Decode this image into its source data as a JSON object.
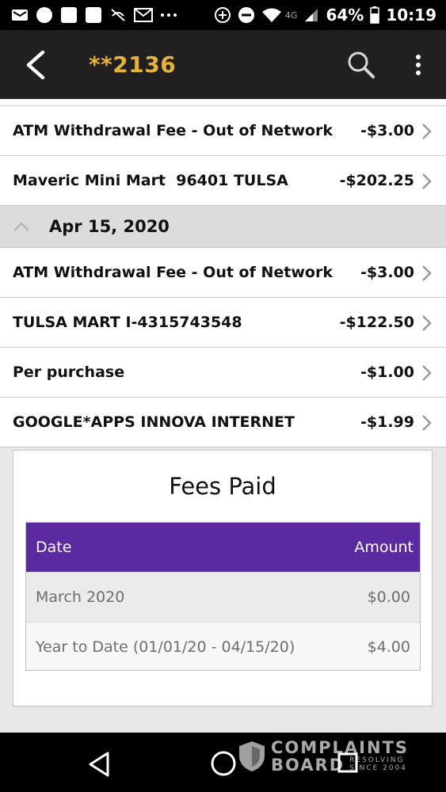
{
  "status_bar": {
    "battery": "64%",
    "time": "10:19",
    "network": "4G"
  },
  "app_bar": {
    "title": "**2136",
    "back_icon": "back-arrow-icon",
    "search_icon": "search-icon",
    "menu_icon": "more-vert-icon"
  },
  "transactions": {
    "group1": [
      {
        "description": "ATM Withdrawal Fee - Out of Network",
        "amount": "-$3.00"
      },
      {
        "description": "Maveric Mini Mart  96401 TULSA",
        "amount": "-$202.25"
      }
    ],
    "group2_date": "Apr 15, 2020",
    "group2": [
      {
        "description": "ATM Withdrawal Fee - Out of Network",
        "amount": "-$3.00"
      },
      {
        "description": "TULSA MART I-4315743548",
        "amount": "-$122.50"
      },
      {
        "description": "Per purchase",
        "amount": "-$1.00"
      },
      {
        "description": "GOOGLE*APPS INNOVA INTERNET",
        "amount": "-$1.99"
      }
    ]
  },
  "fees": {
    "title": "Fees Paid",
    "headers": {
      "date": "Date",
      "amount": "Amount"
    },
    "rows": [
      {
        "date": "March 2020",
        "amount": "$0.00"
      },
      {
        "date": "Year to Date (01/01/20 - 04/15/20)",
        "amount": "$4.00"
      }
    ]
  },
  "watermark": {
    "line1": "COMPLAINTS",
    "line2": "BOARD",
    "tag1": "RESOLVING",
    "tag2": "SINCE 2004"
  },
  "colors": {
    "app_bar": "#221f20",
    "title_accent": "#e3b33c",
    "table_header": "#5b2aa0"
  }
}
